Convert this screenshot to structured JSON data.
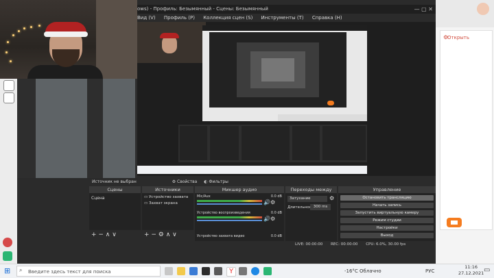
{
  "window": {
    "title": "Профиль: Безымянный - Сцены: Безымянный",
    "title_prefix": "ows) -",
    "menu": [
      "Вид (V)",
      "Профиль (P)",
      "Коллекция сцен (S)",
      "Инструменты (T)",
      "Справка (H)"
    ]
  },
  "source_bar": {
    "no_source": "Источник не выбран",
    "properties": "Свойства",
    "filters": "Фильтры"
  },
  "docks": {
    "scenes": {
      "title": "Сцены",
      "items": [
        "Сцена"
      ]
    },
    "sources": {
      "title": "Источники",
      "items": [
        "Устройство захвата",
        "Захват экрана"
      ]
    },
    "mixer": {
      "title": "Микшер аудио",
      "channels": [
        {
          "name": "Mic/Aux",
          "db": "0.0 dB"
        },
        {
          "name": "Устройство воспроизведения",
          "db": "0.0 dB"
        },
        {
          "name": "Устройство захвата видео",
          "db": "0.0 dB"
        }
      ]
    },
    "transitions": {
      "title": "Переходы между сце...",
      "type": "Затухание",
      "duration_label": "Длительность",
      "duration_value": "300 ms"
    },
    "controls": {
      "title": "Управление",
      "buttons": [
        "Остановить трансляцию",
        "Начать запись",
        "Запустить виртуальную камеру",
        "Режим студии",
        "Настройки",
        "Выход"
      ]
    }
  },
  "status": {
    "live": "LIVE: 00:00:00",
    "rec": "REC: 00:00:00",
    "cpu": "CPU: 6.0%, 30.00 fps"
  },
  "browser_panel": {
    "link": "Открыть"
  },
  "taskbar": {
    "search_placeholder": "Введите здесь текст для поиска",
    "weather": "-16°C Облачно",
    "lang": "РУС",
    "time": "11:16",
    "date": "27.12.2021"
  }
}
